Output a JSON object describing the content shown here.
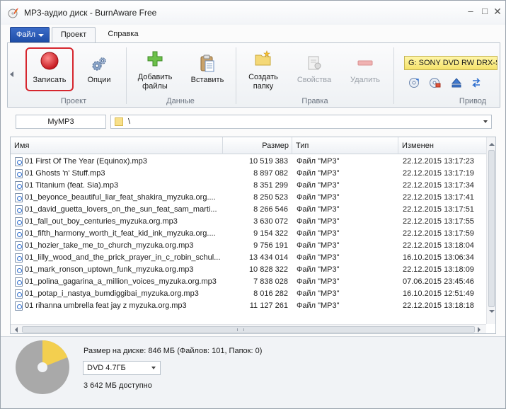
{
  "window": {
    "title": "MP3-аудио диск - BurnAware Free",
    "controls": {
      "minimize": "–",
      "maximize": "□",
      "close": "✕"
    }
  },
  "menu": {
    "file_label": "Файл",
    "tabs": [
      {
        "label": "Проект",
        "active": true
      },
      {
        "label": "Справка",
        "active": false
      }
    ]
  },
  "ribbon": {
    "project": {
      "label": "Проект",
      "record": {
        "label": "Записать",
        "icon": "record-icon"
      },
      "options": {
        "label": "Опции",
        "icon": "gear-icon"
      }
    },
    "data": {
      "label": "Данные",
      "add_files": {
        "label_line1": "Добавить",
        "label_line2": "файлы",
        "icon": "add-icon"
      },
      "paste": {
        "label": "Вставить",
        "icon": "paste-icon"
      }
    },
    "edit": {
      "label": "Правка",
      "new_folder": {
        "label_line1": "Создать",
        "label_line2": "папку",
        "icon": "folder-icon"
      },
      "properties": {
        "label": "Свойства",
        "icon": "properties-icon",
        "enabled": false
      },
      "delete": {
        "label": "Удалить",
        "icon": "minus-icon",
        "enabled": false
      }
    },
    "drive": {
      "label": "Привод",
      "selected": "G: SONY DVD RW DRX-S",
      "icons": [
        "refresh-icon",
        "erase-icon",
        "eject-icon",
        "swap-icon"
      ]
    }
  },
  "path": {
    "disc_name": "MyMP3",
    "current_path": "\\"
  },
  "filelist": {
    "columns": {
      "name": "Имя",
      "size": "Размер",
      "type": "Тип",
      "modified": "Изменен"
    },
    "rows": [
      {
        "name": "01 First Of The Year (Equinox).mp3",
        "size": "10 519 383",
        "type": "Файл \"MP3\"",
        "modified": "22.12.2015 13:17:23"
      },
      {
        "name": "01 Ghosts 'n' Stuff.mp3",
        "size": "8 897 082",
        "type": "Файл \"MP3\"",
        "modified": "22.12.2015 13:17:19"
      },
      {
        "name": "01 Titanium (feat. Sia).mp3",
        "size": "8 351 299",
        "type": "Файл \"MP3\"",
        "modified": "22.12.2015 13:17:34"
      },
      {
        "name": "01_beyonce_beautiful_liar_feat_shakira_myzuka.org....",
        "size": "8 250 523",
        "type": "Файл \"MP3\"",
        "modified": "22.12.2015 13:17:41"
      },
      {
        "name": "01_david_guetta_lovers_on_the_sun_feat_sam_marti...",
        "size": "8 266 546",
        "type": "Файл \"MP3\"",
        "modified": "22.12.2015 13:17:51"
      },
      {
        "name": "01_fall_out_boy_centuries_myzuka.org.mp3",
        "size": "3 630 072",
        "type": "Файл \"MP3\"",
        "modified": "22.12.2015 13:17:55"
      },
      {
        "name": "01_fifth_harmony_worth_it_feat_kid_ink_myzuka.org....",
        "size": "9 154 322",
        "type": "Файл \"MP3\"",
        "modified": "22.12.2015 13:17:59"
      },
      {
        "name": "01_hozier_take_me_to_church_myzuka.org.mp3",
        "size": "9 756 191",
        "type": "Файл \"MP3\"",
        "modified": "22.12.2015 13:18:04"
      },
      {
        "name": "01_lilly_wood_and_the_prick_prayer_in_c_robin_schul...",
        "size": "13 434 014",
        "type": "Файл \"MP3\"",
        "modified": "16.10.2015 13:06:34"
      },
      {
        "name": "01_mark_ronson_uptown_funk_myzuka.org.mp3",
        "size": "10 828 322",
        "type": "Файл \"MP3\"",
        "modified": "22.12.2015 13:18:09"
      },
      {
        "name": "01_polina_gagarina_a_million_voices_myzuka.org.mp3",
        "size": "7 838 028",
        "type": "Файл \"MP3\"",
        "modified": "07.06.2015 23:45:46"
      },
      {
        "name": "01_potap_i_nastya_bumdiggibai_myzuka.org.mp3",
        "size": "8 016 282",
        "type": "Файл \"MP3\"",
        "modified": "16.10.2015 12:51:49"
      },
      {
        "name": "01 rihanna umbrella feat jay z myzuka.org.mp3",
        "size": "11 127 261",
        "type": "Файл \"MP3\"",
        "modified": "22.12.2015 13:18:18"
      }
    ]
  },
  "bottom": {
    "disk_usage_text": "Размер на диске: 846 МБ (Файлов: 101, Папок: 0)",
    "disk_type": "DVD 4.7ГБ",
    "available_text": "3 642 МБ доступно",
    "used_fraction": 0.19,
    "colors": {
      "used": "#f3cf4f",
      "free": "#a9a9a9"
    }
  },
  "colors": {
    "accent": "#1f4ea8",
    "highlight_border": "#d6262e",
    "drive_box": "#f7e67a"
  }
}
